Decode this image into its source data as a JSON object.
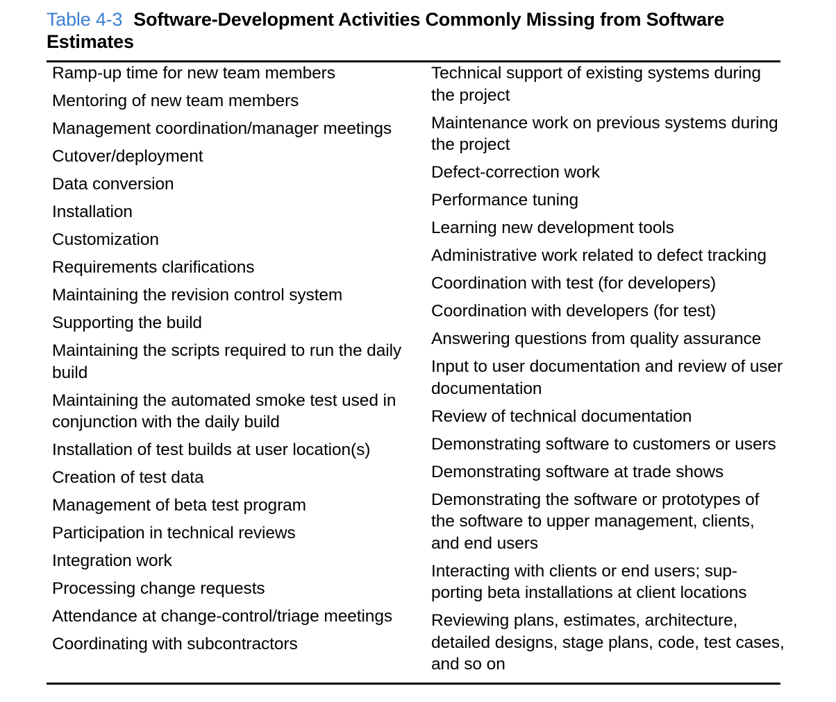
{
  "table": {
    "label": "Table 4-3",
    "title": "Software-Development Activities Commonly Missing from Software Estimates",
    "left_column": [
      "Ramp-up time for new team members",
      "Mentoring of new team members",
      "Management coordination/manager meetings",
      "Cutover/deployment",
      "Data conversion",
      "Installation",
      "Customization",
      "Requirements clarifications",
      "Maintaining the revision control system",
      "Supporting the build",
      "Maintaining the scripts required to run the daily build",
      "Maintaining the automated smoke test used in conjunction with the daily build",
      "Installation of test builds at user location(s)",
      "Creation of test data",
      "Management of beta test program",
      "Participation in technical reviews",
      "Integration work",
      "Processing change requests",
      "Attendance at change-control/triage meetings",
      "Coordinating with subcontractors"
    ],
    "right_column": [
      "Technical support of existing systems during the project",
      "Maintenance work on previous systems during the project",
      "Defect-correction work",
      "Performance tuning",
      "Learning new development tools",
      "Administrative work related to defect tracking",
      "Coordination with test (for developers)",
      "Coordination with developers (for test)",
      "Answering questions from quality assurance",
      "Input to user documentation and review of user documentation",
      "Review of technical documentation",
      "Demonstrating software to customers or users",
      "Demonstrating software at trade shows",
      "Demonstrating the software or prototypes of the software to upper management, clients, and end users",
      "Interacting with clients or end users; sup-porting beta installations at client locations",
      "Reviewing plans, estimates, architecture, detailed designs, stage plans, code, test cases, and so on"
    ]
  },
  "colors": {
    "label": "#3b7fd1",
    "text": "#000000",
    "rule": "#000000"
  }
}
